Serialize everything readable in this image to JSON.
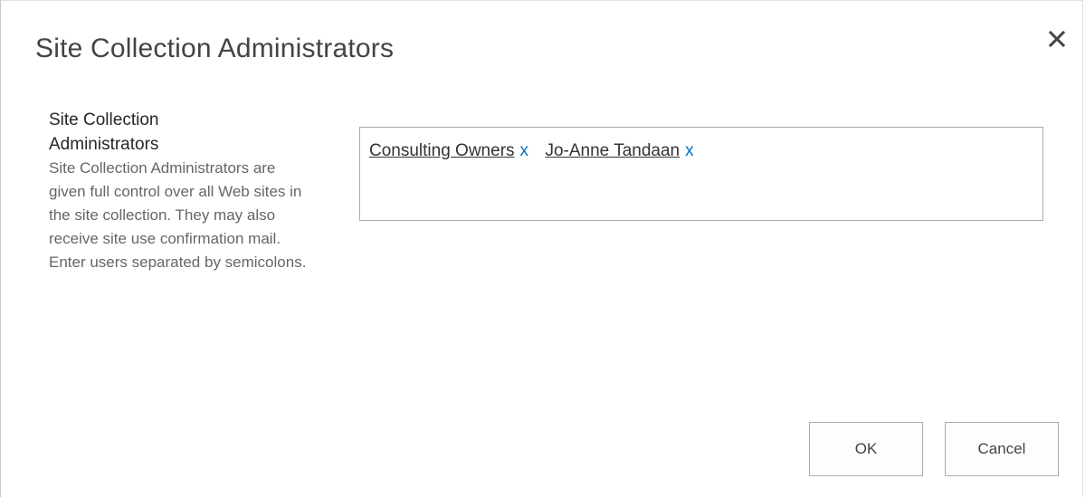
{
  "dialog": {
    "title": "Site Collection Administrators",
    "close_icon": "close-icon"
  },
  "section": {
    "heading": "Site Collection Administrators",
    "description": "Site Collection Administrators are given full control over all Web sites in the site collection. They may also receive site use confirmation mail. Enter users separated by semicolons."
  },
  "people_picker": {
    "entities": [
      {
        "name": "Consulting Owners",
        "remove_label": "x"
      },
      {
        "name": "Jo-Anne Tandaan",
        "remove_label": "x"
      }
    ]
  },
  "buttons": {
    "ok_label": "OK",
    "cancel_label": "Cancel"
  },
  "colors": {
    "remove_link": "#0072c6",
    "title_text": "#444444",
    "description_text": "#666666"
  }
}
